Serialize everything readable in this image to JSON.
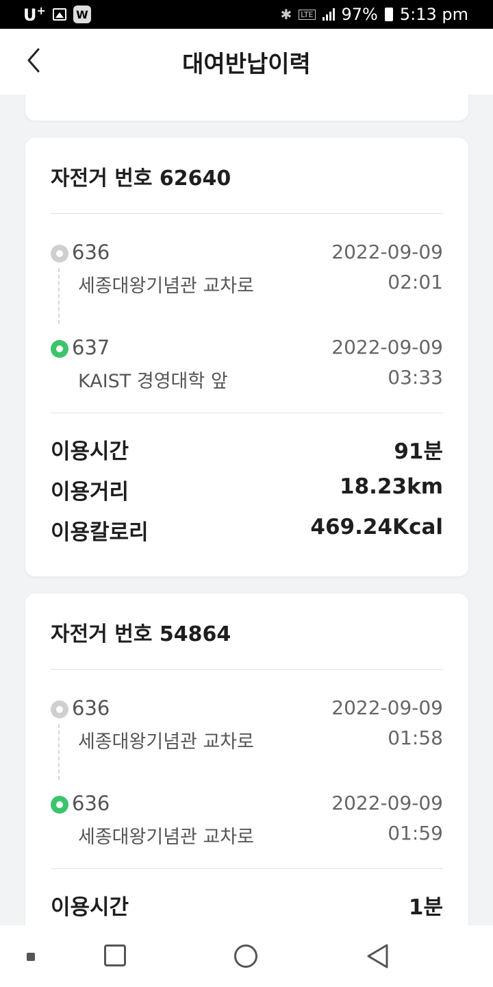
{
  "status_bar": {
    "carrier": "U",
    "carrier_sup": "+",
    "app_badge": "W",
    "network": "LTE",
    "battery": "97%",
    "time": "5:13 pm"
  },
  "header": {
    "title": "대여반납이력"
  },
  "rentals": [
    {
      "bike_title": "자전거 번호 62640",
      "start": {
        "station_no": "636",
        "station_name": "세종대왕기념관 교차로",
        "date": "2022-09-09",
        "time": "02:01"
      },
      "end": {
        "station_no": "637",
        "station_name": "KAIST 경영대학 앞",
        "date": "2022-09-09",
        "time": "03:33"
      },
      "stats": [
        {
          "label": "이용시간",
          "value": "91분"
        },
        {
          "label": "이용거리",
          "value": "18.23km"
        },
        {
          "label": "이용칼로리",
          "value": "469.24Kcal"
        }
      ]
    },
    {
      "bike_title": "자전거 번호 54864",
      "start": {
        "station_no": "636",
        "station_name": "세종대왕기념관 교차로",
        "date": "2022-09-09",
        "time": "01:58"
      },
      "end": {
        "station_no": "636",
        "station_name": "세종대왕기념관 교차로",
        "date": "2022-09-09",
        "time": "01:59"
      },
      "stats": [
        {
          "label": "이용시간",
          "value": "1분"
        }
      ]
    }
  ],
  "colors": {
    "start_dot": "#cfcfcf",
    "end_dot": "#3cc46c",
    "background": "#f2f3f5"
  }
}
